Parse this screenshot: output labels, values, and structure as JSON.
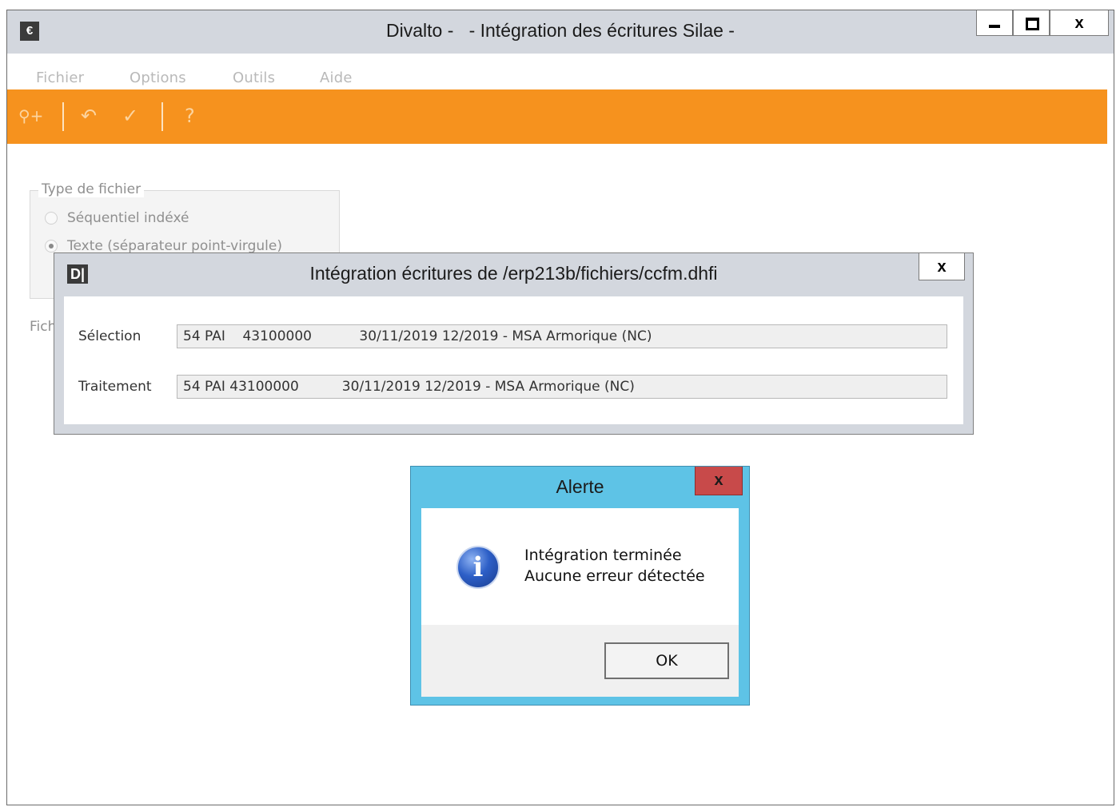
{
  "window": {
    "app_icon": "€",
    "title": "Divalto -   - Intégration des écritures Silae -",
    "minimize": "minimize-icon",
    "maximize": "maximize-icon",
    "close_label": "x"
  },
  "menu": {
    "items": [
      {
        "label": "Fichier"
      },
      {
        "label": "Options"
      },
      {
        "label": "Outils"
      },
      {
        "label": "Aide"
      }
    ]
  },
  "toolbar": {
    "accent": "#f6921e",
    "icons": [
      "search-add-icon",
      "undo-icon",
      "checkmark-icon",
      "help-icon"
    ],
    "glyphs": {
      "search": "⚲+",
      "undo": "↶",
      "check": "✓",
      "help": "?"
    }
  },
  "form": {
    "group_label": "Type de fichier",
    "radios": [
      {
        "label": "Séquentiel indéxé",
        "checked": false
      },
      {
        "label": "Texte (séparateur point-virgule)",
        "checked": true
      }
    ],
    "fichier_label": "Fichi"
  },
  "dialog": {
    "icon": "D|",
    "title": "Intégration écritures de /erp213b/fichiers/ccfm.dhfi",
    "close_label": "x",
    "fields": [
      {
        "label": "Sélection",
        "value": "54 PAI    43100000           30/11/2019 12/2019 - MSA Armorique (NC)"
      },
      {
        "label": "Traitement",
        "value": "54 PAI 43100000          30/11/2019 12/2019 - MSA Armorique (NC)"
      }
    ]
  },
  "alert": {
    "title": "Alerte",
    "close_label": "x",
    "icon": "info-icon",
    "icon_glyph": "i",
    "line1": "Intégration terminée",
    "line2": "Aucune erreur détectée",
    "ok_label": "OK",
    "title_color": "#5ec3e6",
    "close_color": "#c84a4a"
  }
}
